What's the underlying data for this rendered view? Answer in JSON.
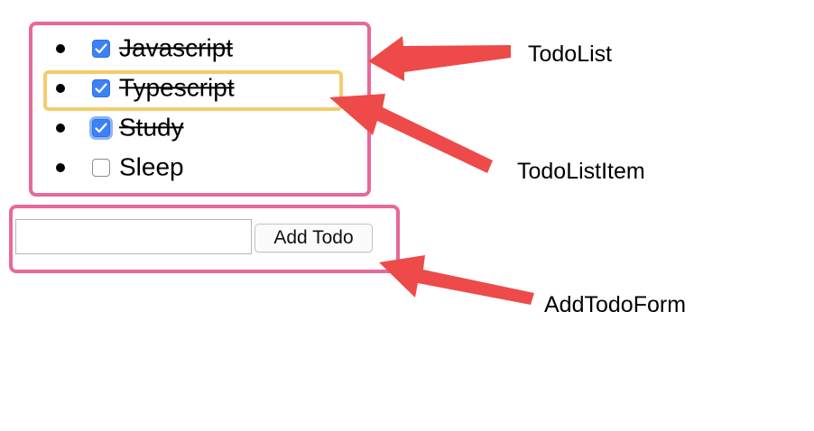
{
  "todo_list": {
    "items": [
      {
        "label": "Javascript",
        "checked": true,
        "done": true,
        "focused": false
      },
      {
        "label": "Typescript",
        "checked": true,
        "done": true,
        "focused": false
      },
      {
        "label": "Study",
        "checked": true,
        "done": true,
        "focused": true
      },
      {
        "label": "Sleep",
        "checked": false,
        "done": false,
        "focused": false
      }
    ]
  },
  "add_form": {
    "input_value": "",
    "input_placeholder": "",
    "button_label": "Add Todo"
  },
  "annotations": {
    "todo_list_label": "TodoList",
    "todo_list_item_label": "TodoListItem",
    "add_todo_form_label": "AddTodoForm"
  },
  "colors": {
    "component_outline": "#e8689a",
    "item_outline": "#f5cc6a",
    "arrow": "#ee4a4a",
    "checkbox_checked": "#3b82f6"
  }
}
